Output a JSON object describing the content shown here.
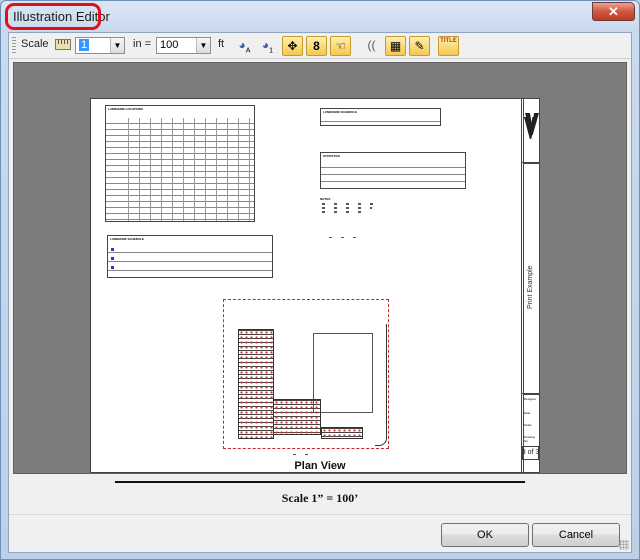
{
  "window": {
    "title": "Illustration Editor",
    "close_glyph": "✕"
  },
  "toolbar": {
    "scale_label": "Scale",
    "scale_value": "1",
    "in_label": "in =",
    "ft_value": "100",
    "ft_label": "ft",
    "icons": [
      "ruler-icon",
      "color-a-icon",
      "color-1-icon",
      "move-arrows-icon",
      "number-8-icon",
      "hand-icon",
      "curve-lines-icon",
      "grid-icon",
      "edit-icon",
      "title-block-icon"
    ],
    "title_icon_text": "TITLE"
  },
  "sheet": {
    "table1_title": "LUMINAIRE LOCATIONS",
    "table2_title": "LUMINAIRE SCHEDULE",
    "table3_title": "LUMINAIRE SCHEDULE",
    "table4_title": "STATISTICS",
    "notes_title": "NOTES",
    "vertical_label": "Print Example",
    "page_number": "3 of 3",
    "tb_designer": "Designer",
    "tb_date": "Date",
    "tb_scale": "Scale",
    "tb_drawing": "Drawing No."
  },
  "plan_view": "Plan View",
  "scale_text": "Scale  1” = 100’",
  "buttons": {
    "ok": "OK",
    "cancel": "Cancel"
  }
}
